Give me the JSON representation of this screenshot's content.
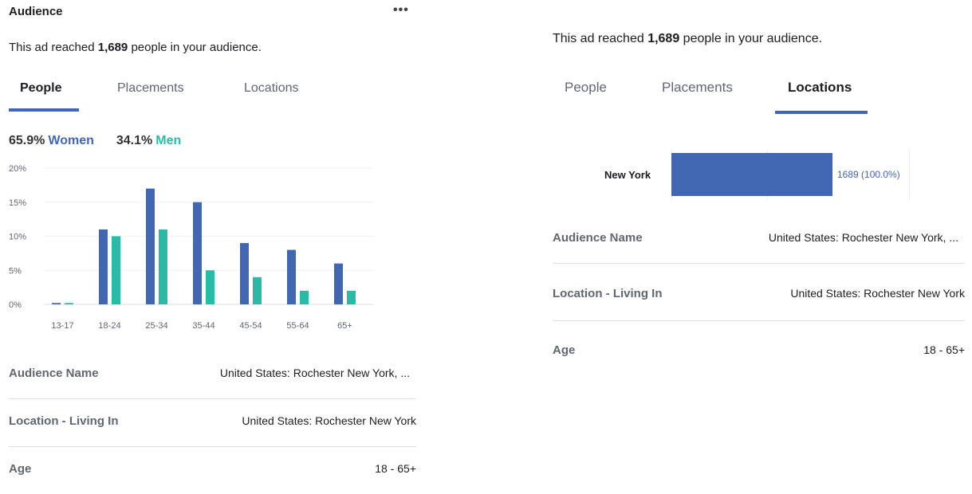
{
  "left_panel": {
    "title": "Audience",
    "more_icon": "•••",
    "reach": {
      "prefix": "This ad reached ",
      "count": "1,689",
      "suffix": " people in your audience."
    },
    "tabs": [
      {
        "label": "People",
        "active": true
      },
      {
        "label": "Placements",
        "active": false
      },
      {
        "label": "Locations",
        "active": false
      }
    ],
    "gender": {
      "women_pct": "65.9%",
      "women_label": "Women",
      "men_pct": "34.1%",
      "men_label": "Men"
    },
    "details": [
      {
        "key": "Audience Name",
        "value": "United States: Rochester New York, ..."
      },
      {
        "key": "Location - Living In",
        "value": "United States: Rochester New York"
      },
      {
        "key": "Age",
        "value": "18 - 65+"
      }
    ]
  },
  "right_panel": {
    "reach": {
      "prefix": "This ad reached ",
      "count": "1,689",
      "suffix": " people in your audience."
    },
    "tabs": [
      {
        "label": "People",
        "active": false
      },
      {
        "label": "Placements",
        "active": false
      },
      {
        "label": "Locations",
        "active": true
      }
    ],
    "location": {
      "name": "New York",
      "value_label": "1689 (100.0%)",
      "share": 1.0
    },
    "details": [
      {
        "key": "Audience Name",
        "value": "United States: Rochester New York, ..."
      },
      {
        "key": "Location - Living In",
        "value": "United States: Rochester New York"
      },
      {
        "key": "Age",
        "value": "18 - 65+"
      }
    ]
  },
  "colors": {
    "women": "#4267b2",
    "men": "#2abba7",
    "accent": "#4267b2"
  },
  "chart_data": {
    "type": "bar",
    "categories": [
      "13-17",
      "18-24",
      "25-34",
      "35-44",
      "45-54",
      "55-64",
      "65+"
    ],
    "series": [
      {
        "name": "Women",
        "values": [
          0.2,
          11,
          17,
          15,
          9,
          8,
          6
        ]
      },
      {
        "name": "Men",
        "values": [
          0.2,
          10,
          11,
          5,
          4,
          2,
          2
        ]
      }
    ],
    "yticks": [
      "0%",
      "5%",
      "10%",
      "15%",
      "20%"
    ],
    "ylim": [
      0,
      20
    ],
    "grid": true
  }
}
